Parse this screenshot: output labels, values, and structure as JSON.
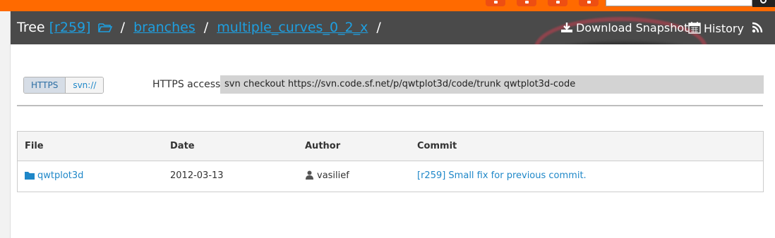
{
  "top_bar": {
    "accent": "#ff6a00",
    "social_icons": [
      "social-icon-1",
      "social-icon-2",
      "social-icon-3",
      "social-icon-4"
    ],
    "search_placeholder": ""
  },
  "header": {
    "tree_label": "Tree",
    "revision": "[r259]",
    "separator": "/",
    "branches": "branches",
    "current": "multiple_curves_0_2_x",
    "download_label": "Download Snapshot",
    "history_label": "History"
  },
  "access": {
    "tabs": [
      {
        "label": "HTTPS",
        "active": true
      },
      {
        "label": "svn://",
        "active": false
      }
    ],
    "label": "HTTPS access",
    "command": "svn checkout https://svn.code.sf.net/p/qwtplot3d/code/trunk qwtplot3d-code"
  },
  "table": {
    "columns": [
      "File",
      "Date",
      "Author",
      "Commit"
    ],
    "rows": [
      {
        "file": "qwtplot3d",
        "date": "2012-03-13",
        "author": "vasilief",
        "commit": "[r259] Small fix for previous commit."
      }
    ]
  },
  "colors": {
    "link": "#1e87c8",
    "header_bg": "#4a4a4a",
    "header_link": "#1e9fe0"
  }
}
